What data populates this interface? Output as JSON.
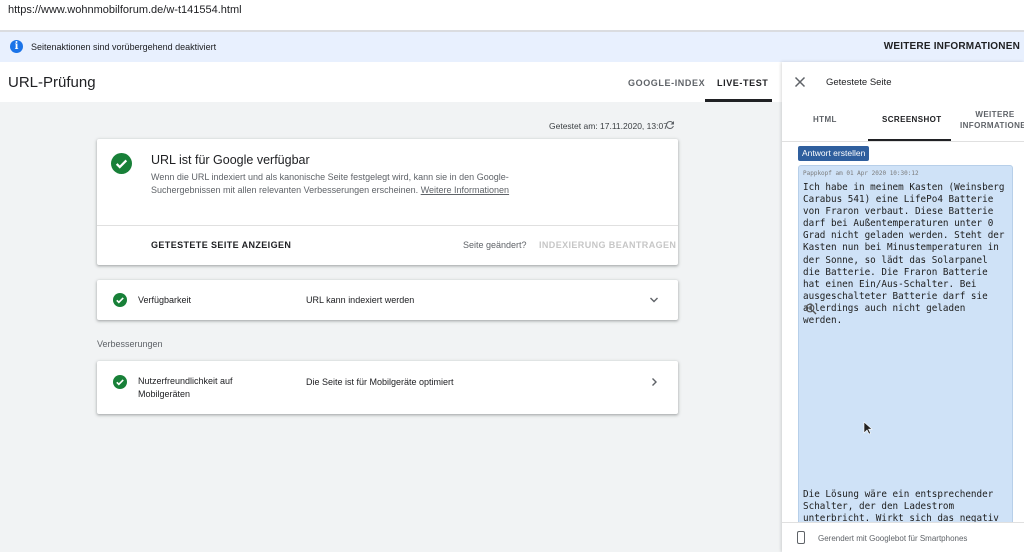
{
  "browser": {
    "url": "https://www.wohnmobilforum.de/w-t141554.html"
  },
  "infobar": {
    "text": "Seitenaktionen sind vorübergehend deaktiviert",
    "more": "WEITERE INFORMATIONEN"
  },
  "header": {
    "title": "URL-Prüfung",
    "tabs": [
      {
        "label": "GOOGLE-INDEX"
      },
      {
        "label": "LIVE-TEST",
        "active": true
      }
    ]
  },
  "main": {
    "tested_on": "Getestet am: 17.11.2020, 13:07",
    "status_card": {
      "title": "URL ist für Google verfügbar",
      "description": "Wenn die URL indexiert und als kanonische Seite festgelegt wird, kann sie in den Google-Suchergebnissen mit allen relevanten Verbesserungen erscheinen.",
      "link": "Weitere Informationen",
      "show_tested_page": "GETESTETE SEITE ANZEIGEN",
      "page_changed": "Seite geändert?",
      "request_indexing": "INDEXIERUNG BEANTRAGEN"
    },
    "availability": {
      "label": "Verfügbarkeit",
      "value": "URL kann indexiert werden"
    },
    "improvements_title": "Verbesserungen",
    "mobile": {
      "label_line1": "Nutzerfreundlichkeit auf",
      "label_line2": "Mobilgeräten",
      "value": "Die Seite ist für Mobilgeräte optimiert"
    }
  },
  "panel": {
    "title": "Getestete Seite",
    "tabs": [
      {
        "label": "HTML"
      },
      {
        "label": "SCREENSHOT",
        "active": true
      },
      {
        "label_line1": "WEITERE",
        "label_line2": "INFORMATIONEN"
      }
    ],
    "screenshot": {
      "reply_button": "Antwort erstellen",
      "post_meta": "Pappkopf am 01 Apr 2020 10:30:12",
      "post_text": "Ich habe in meinem Kasten (Weinsberg Carabus 541) eine LifePo4 Batterie von Fraron verbaut. Diese Batterie darf bei Außentemperaturen unter 0 Grad nicht geladen werden. Steht der Kasten nun bei Minustemperaturen in der Sonne, so lädt das Solarpanel die Batterie. Die Fraron Batterie hat einen Ein/Aus-Schalter. Bei ausgeschalteter Batterie darf sie allerdings auch nicht geladen werden.",
      "post_text2": "Die Lösung wäre ein entsprechender Schalter, der den Ladestrom unterbricht. Wirkt sich das negativ auf das Panel aus?"
    },
    "footer": "Gerendert mit Googlebot für Smartphones"
  },
  "colors": {
    "accent_green": "#188038",
    "info_blue": "#1a73e8",
    "infobar_bg": "#e8f0fe",
    "post_bg": "#cfe2f7"
  },
  "icons": [
    "info-icon",
    "refresh-icon",
    "check-circle-icon",
    "chevron-down-icon",
    "chevron-right-icon",
    "close-icon",
    "zoom-in-icon",
    "smartphone-icon",
    "mouse-cursor-icon"
  ]
}
